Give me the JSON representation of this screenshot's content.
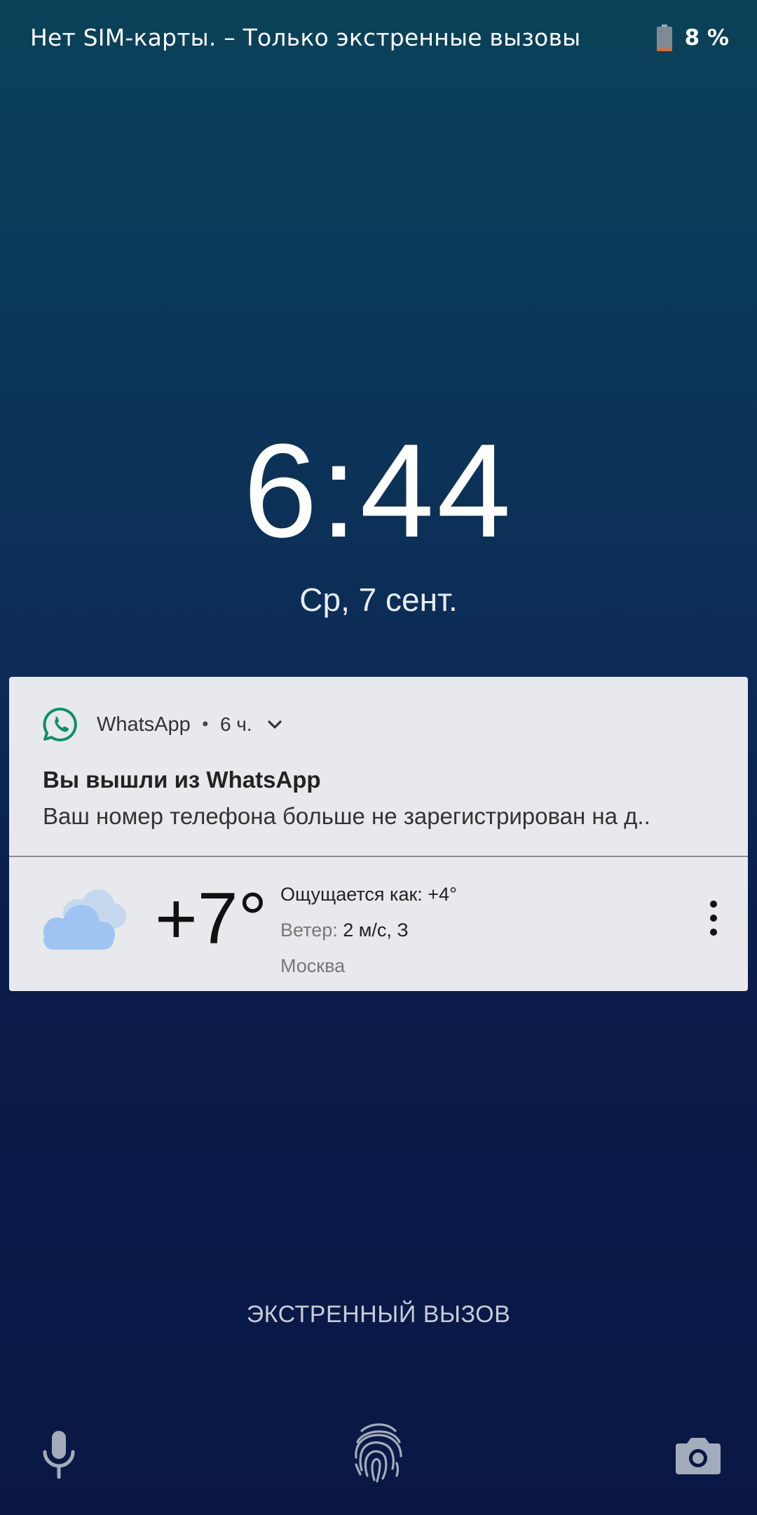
{
  "status_bar": {
    "carrier_text": "Нет SIM-карты. – Только экстренные вызовы",
    "battery_text": "8 %",
    "battery_level_percent": 8,
    "icons": [
      "battery-low-icon"
    ]
  },
  "lock_screen": {
    "time": "6:44",
    "date": "Ср, 7 сент."
  },
  "notification": {
    "app_name": "WhatsApp",
    "separator": "•",
    "time_ago": "6 ч.",
    "title": "Вы вышли из WhatsApp",
    "body": "Ваш номер телефона больше не зарегистрирован на д..",
    "icons": [
      "whatsapp-icon",
      "chevron-down-icon"
    ]
  },
  "weather": {
    "temperature": "+7°",
    "feels_like": "Ощущается как: +4°",
    "wind_label": "Ветер:",
    "wind_value": "2 м/с, З",
    "city": "Москва",
    "icons": [
      "cloud-icon",
      "more-vert-icon"
    ]
  },
  "emergency_call": {
    "label": "ЭКСТРЕННЫЙ ВЫЗОВ"
  },
  "bottom_bar": {
    "icons": [
      "microphone-icon",
      "fingerprint-icon",
      "camera-icon"
    ]
  },
  "colors": {
    "background_top": "#0a4259",
    "background_bottom": "#0a1745",
    "card_background": "#e8e9ec",
    "whatsapp_green": "#0f8f6c",
    "battery_low": "#e8672a",
    "cloud_blue": "#9fc4f4"
  }
}
